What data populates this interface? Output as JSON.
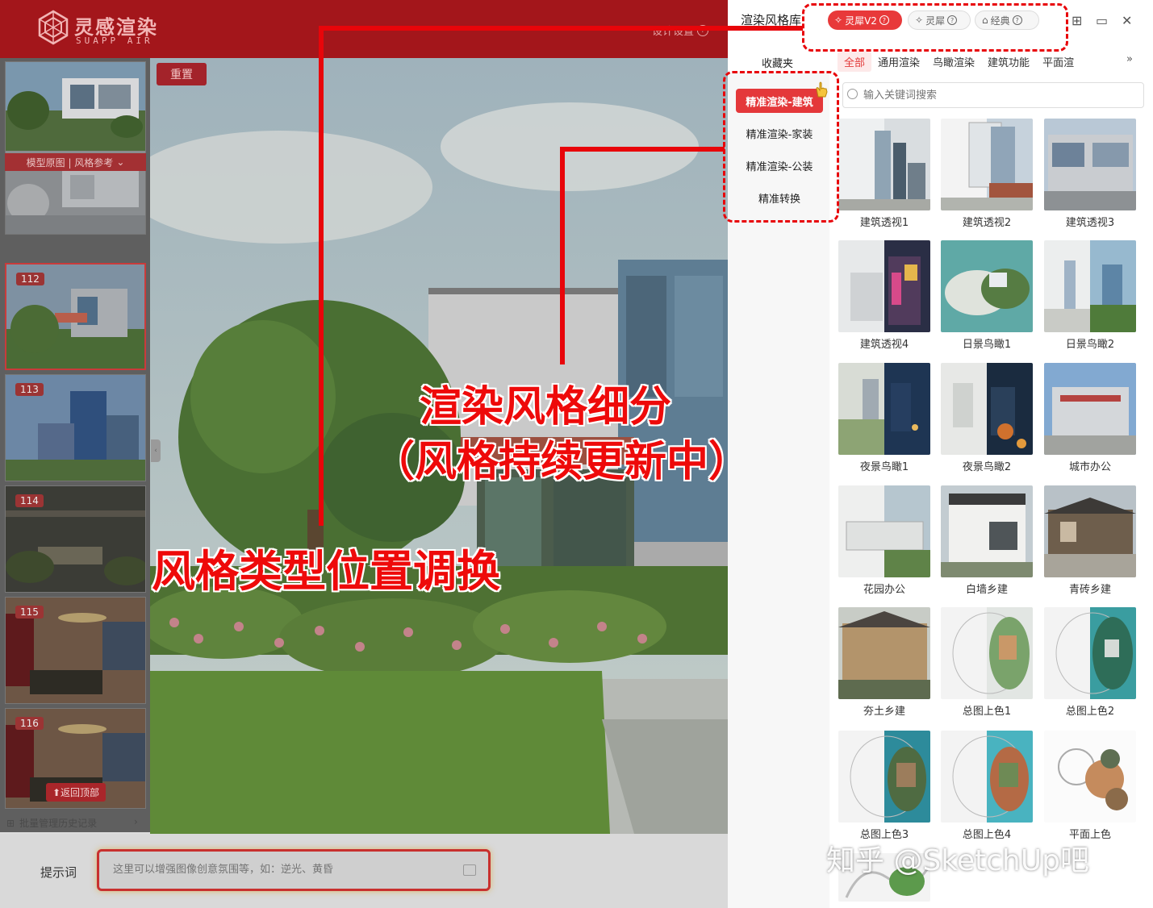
{
  "app": {
    "brand_cn": "灵感渲染",
    "brand_en": "SUAPP AIR",
    "settings_link": "设计设置",
    "reset_button": "重置",
    "thumb_ref_label": "模型原图 | 风格参考",
    "thumb_numbers": [
      "112",
      "113",
      "114",
      "115",
      "116"
    ],
    "back_to_top": "⬆返回顶部",
    "history": "批量管理历史记录",
    "prompt_label": "提示词",
    "prompt_placeholder": "这里可以增强图像创意氛围等，如：逆光、黄昏"
  },
  "panel": {
    "title": "渲染风格库",
    "modes": [
      {
        "label": "灵犀V2",
        "active": true
      },
      {
        "label": "灵犀",
        "active": false
      },
      {
        "label": "经典",
        "active": false
      }
    ],
    "favorites": "收藏夹",
    "categories": [
      "全部",
      "通用渲染",
      "鸟瞰渲染",
      "建筑功能",
      "平面渲"
    ],
    "subcategories": [
      "精准渲染-建筑",
      "精准渲染-家装",
      "精准渲染-公装",
      "精准转换"
    ],
    "search_placeholder": "输入关键词搜索",
    "styles": [
      "建筑透视1",
      "建筑透视2",
      "建筑透视3",
      "建筑透视4",
      "日景鸟瞰1",
      "日景鸟瞰2",
      "夜景鸟瞰1",
      "夜景鸟瞰2",
      "城市办公",
      "花园办公",
      "白墙乡建",
      "青砖乡建",
      "夯土乡建",
      "总图上色1",
      "总图上色2",
      "总图上色3",
      "总图上色4",
      "平面上色"
    ]
  },
  "annotations": {
    "subdivide_line1": "渲染风格细分",
    "subdivide_line2": "（风格持续更新中）",
    "swap": "风格类型位置调换"
  },
  "watermark": "知乎 @SketchUp吧",
  "colors": {
    "brand_red": "#a3161b",
    "accent_red": "#e4383a",
    "annotation_red": "#e8050a"
  }
}
